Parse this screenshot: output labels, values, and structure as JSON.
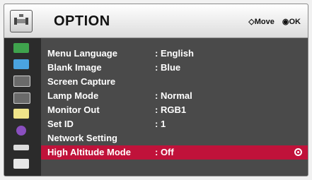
{
  "header": {
    "title": "OPTION",
    "hint_move": "Move",
    "hint_ok": "OK",
    "move_glyph": "◇",
    "ok_glyph": "◉"
  },
  "sidebar": {
    "icons": [
      {
        "name": "picture-icon",
        "color": "#3fa34d"
      },
      {
        "name": "audio-icon",
        "color": "#4aa3e0"
      },
      {
        "name": "timer-icon",
        "color": "#e8e8e8"
      },
      {
        "name": "clock-icon",
        "color": "#e8e8e8"
      },
      {
        "name": "option-icon",
        "color": "#f0e58a"
      },
      {
        "name": "info-icon",
        "color": "#8a4fbf"
      },
      {
        "name": "input-icon",
        "color": "#dcdcdc"
      },
      {
        "name": "media-icon",
        "color": "#e8e8e8"
      }
    ]
  },
  "menu": {
    "items": [
      {
        "label": "Menu Language",
        "value": ": English"
      },
      {
        "label": "Blank Image",
        "value": ": Blue"
      },
      {
        "label": "Screen Capture",
        "value": ""
      },
      {
        "label": "Lamp Mode",
        "value": ": Normal"
      },
      {
        "label": "Monitor Out",
        "value": ": RGB1"
      },
      {
        "label": "Set ID",
        "value": ": 1"
      },
      {
        "label": "Network Setting",
        "value": ""
      },
      {
        "label": "High Altitude Mode",
        "value": ": Off"
      }
    ],
    "selected_index": 7
  },
  "colors": {
    "selection": "#c0123a",
    "panel_bg": "#4a4a4a",
    "header_bg": "#eeeeee"
  }
}
